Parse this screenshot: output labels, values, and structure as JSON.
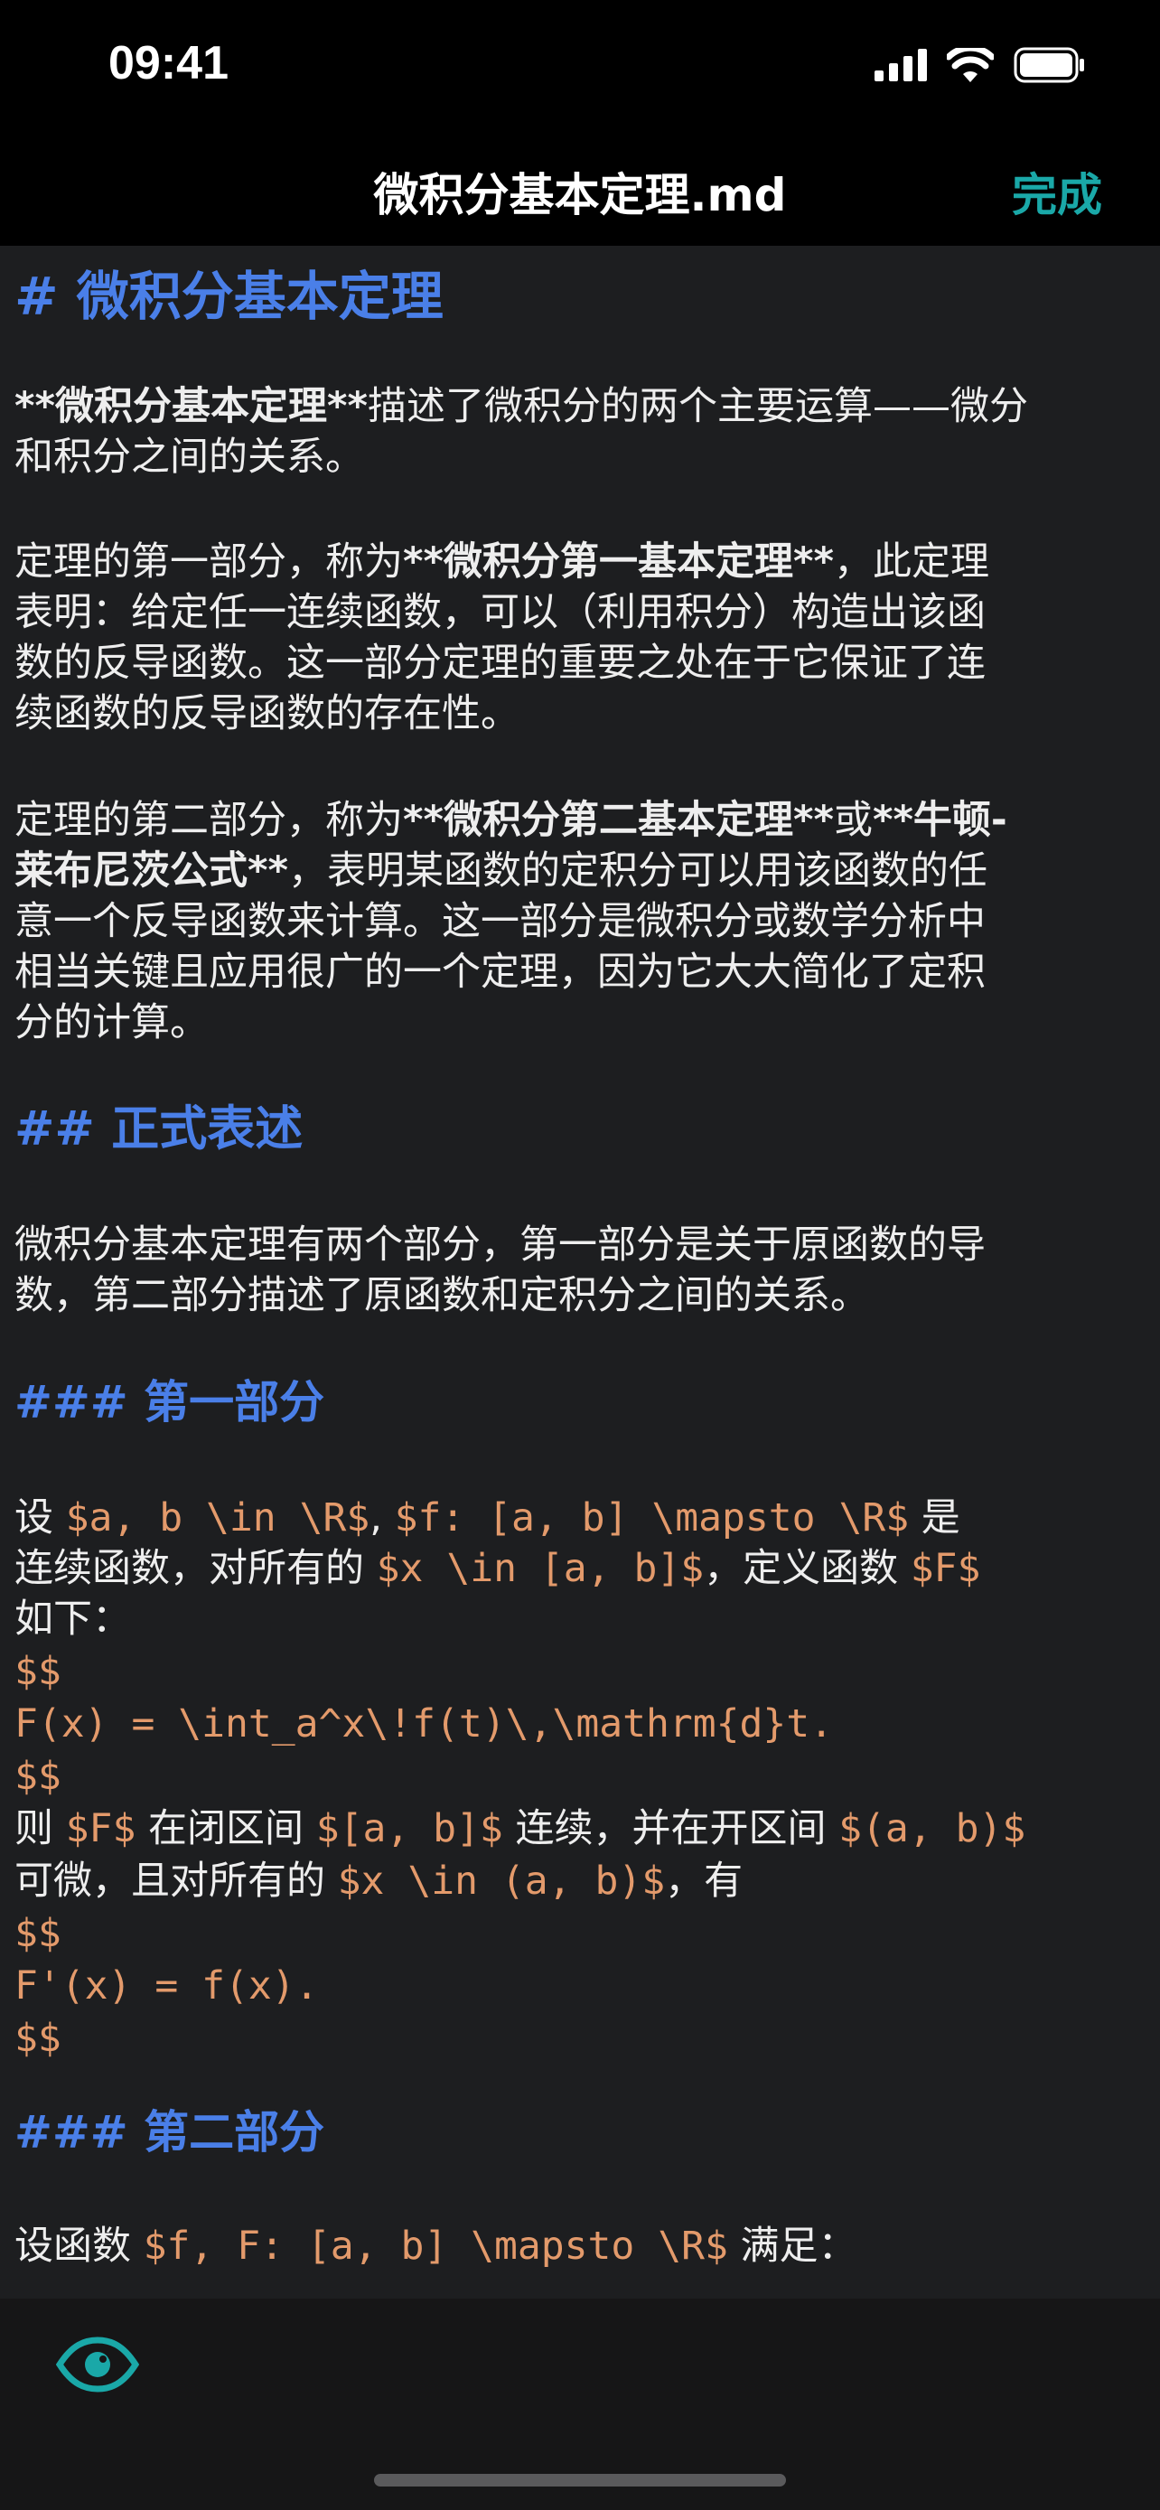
{
  "status_bar": {
    "time": "09:41"
  },
  "nav": {
    "title": "微积分基本定理.md",
    "done_label": "完成"
  },
  "editor": {
    "h1": "# 微积分基本定理",
    "p1": {
      "l1_bold": "**微积分基本定理**",
      "l1_rest": "描述了微积分的两个主要运算——微分",
      "l2": "和积分之间的关系。"
    },
    "p2": {
      "l1_a": "定理的第一部分，称为",
      "l1_bold": "**微积分第一基本定理**",
      "l1_b": "，此定理",
      "l2": "表明：给定任一连续函数，可以（利用积分）构造出该函",
      "l3": "数的反导函数。这一部分定理的重要之处在于它保证了连",
      "l4": "续函数的反导函数的存在性。"
    },
    "p3": {
      "l1_a": "定理的第二部分，称为",
      "l1_bold1": "**微积分第二基本定理**",
      "l1_b": "或",
      "l1_bold2": "**牛顿-",
      "l2_bold": "莱布尼茨公式**",
      "l2_rest": "，表明某函数的定积分可以用该函数的任",
      "l3": "意一个反导函数来计算。这一部分是微积分或数学分析中",
      "l4": "相当关键且应用很广的一个定理，因为它大大简化了定积",
      "l5": "分的计算。"
    },
    "h2": "## 正式表述",
    "p4": {
      "l1": "微积分基本定理有两个部分，第一部分是关于原函数的导",
      "l2": "数，第二部分描述了原函数和定积分之间的关系。"
    },
    "h3_part1": "### 第一部分",
    "p5": {
      "l1_a": "设 ",
      "l1_m1": "$a, b \\in \\R$",
      "l1_b": ", ",
      "l1_m2": "$f: [a, b] \\mapsto \\R$",
      "l1_c": " 是",
      "l2_a": "连续函数，对所有的 ",
      "l2_m1": "$x \\in [a, b]$",
      "l2_b": "，定义函数 ",
      "l2_m2": "$F$",
      "l3": "如下：",
      "l4": "$$",
      "l5": "F(x) = \\int_a^x\\!f(t)\\,\\mathrm{d}t.",
      "l6": "$$",
      "l7_a": "则 ",
      "l7_m1": "$F$",
      "l7_b": " 在闭区间 ",
      "l7_m2": "$[a, b]$",
      "l7_c": " 连续，并在开区间 ",
      "l7_m3": "$(a, b)$",
      "l8_a": "可微，且对所有的 ",
      "l8_m1": "$x \\in (a, b)$",
      "l8_b": "，有",
      "l9": "$$",
      "l10": "F'(x) = f(x).",
      "l11": "$$"
    },
    "h3_part2": "### 第二部分",
    "p6": {
      "l1_a": "设函数 ",
      "l1_m1": "$f, F: [a, b] \\mapsto \\R$",
      "l1_b": " 满足："
    }
  },
  "toolbar": {
    "preview_icon": "eye-icon"
  },
  "colors": {
    "accent": "#1aa8a8",
    "heading": "#4a7fe8",
    "math": "#e39a6b"
  }
}
